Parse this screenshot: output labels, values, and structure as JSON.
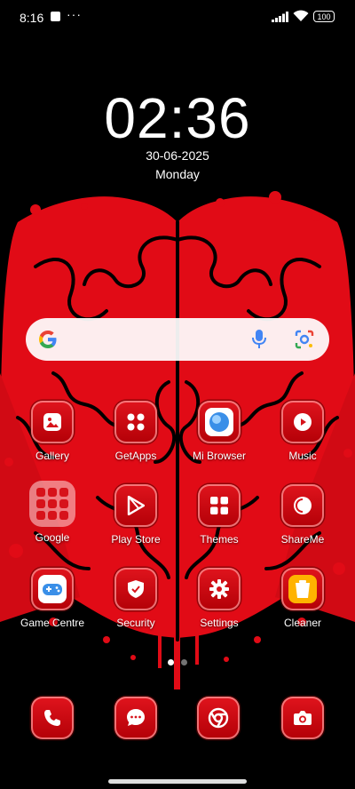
{
  "status_bar": {
    "time": "8:16",
    "dots": "···",
    "battery": "100"
  },
  "clock_widget": {
    "time": "02:36",
    "date": "30-06-2025",
    "day": "Monday"
  },
  "search_widget": {
    "logo": "google-g-icon",
    "mic": "mic-icon",
    "lens": "lens-icon"
  },
  "apps": {
    "row1": [
      "Gallery",
      "GetApps",
      "Mi Browser",
      "Music"
    ],
    "row2": [
      "Google",
      "Play Store",
      "Themes",
      "ShareMe"
    ],
    "row3": [
      "Game Centre",
      "Security",
      "Settings",
      "Cleaner"
    ]
  },
  "dock": [
    "phone-icon",
    "messages-icon",
    "chrome-icon",
    "camera-icon"
  ],
  "page_indicator": {
    "pages": 2,
    "current": 1
  },
  "colors": {
    "accent": "#d7121a",
    "background": "#000000"
  }
}
